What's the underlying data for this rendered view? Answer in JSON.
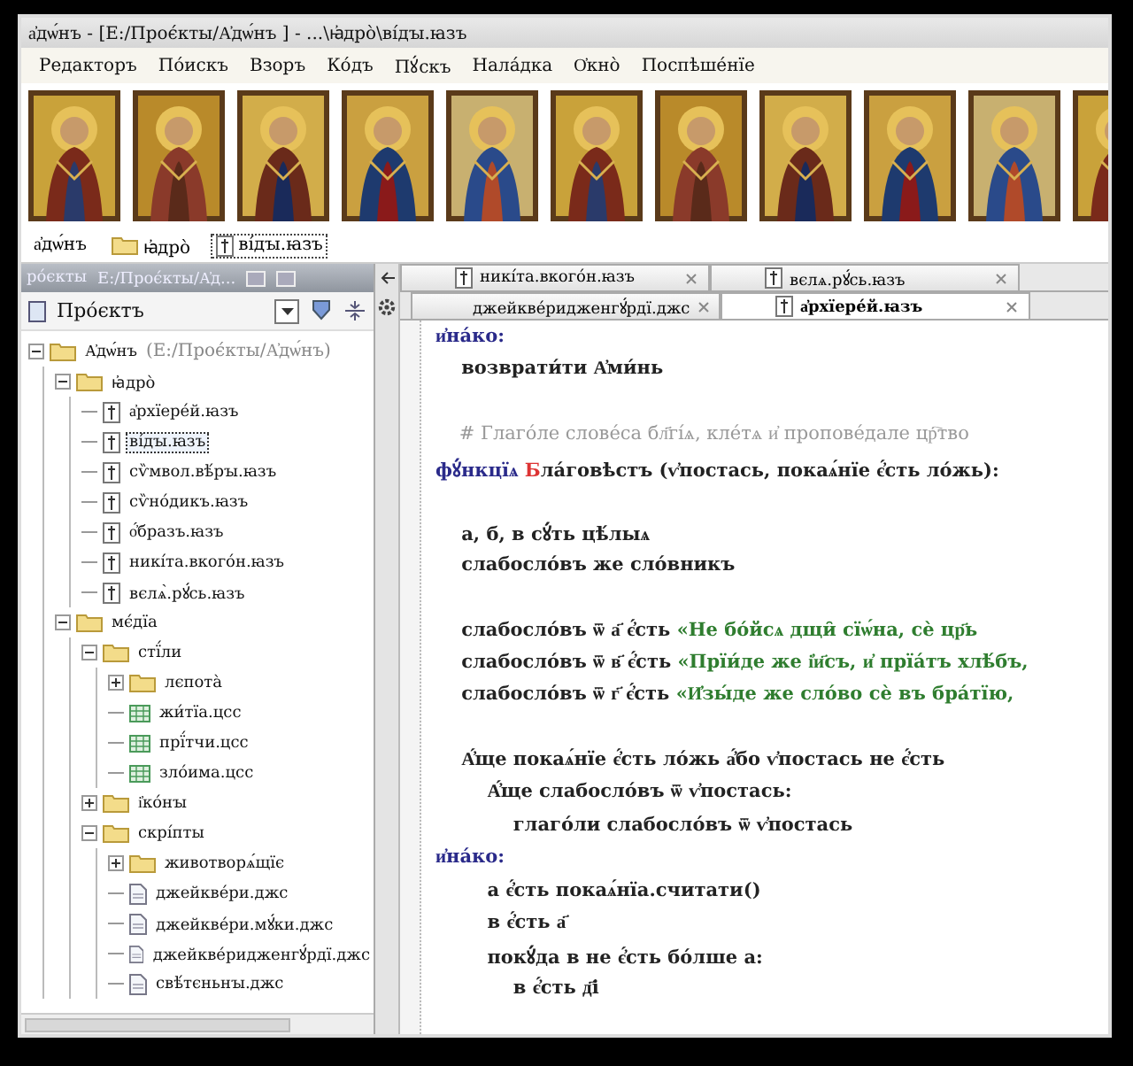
{
  "window": {
    "title": "а҆дѡ́нъ - [Е:/Проє́кты/А҆дѡ́нъ ] - ...\\ꙗ҆дро̀\\ві́дꙑ.ꙗзъ"
  },
  "menu": [
    "Редакторъ",
    "По́искъ",
    "Взоръ",
    "Ко́дъ",
    "Пꙋ́скъ",
    "Нала́дка",
    "О҆кно̀",
    "Поспѣше́нїе"
  ],
  "icon_strip": [
    {
      "kind": "picture"
    },
    {
      "kind": "picture"
    },
    {
      "kind": "picture"
    },
    {
      "kind": "picture"
    },
    {
      "kind": "picture"
    },
    {
      "kind": "picture"
    },
    {
      "kind": "picture"
    },
    {
      "kind": "picture"
    },
    {
      "kind": "picture"
    },
    {
      "kind": "picture"
    },
    {
      "kind": "picture"
    }
  ],
  "breadcrumb": [
    {
      "label": "а҆дѡ́нъ"
    },
    {
      "label": "ꙗ҆дро̀",
      "kind": "folder"
    },
    {
      "label": "ві́дꙑ.ꙗзъ",
      "kind": "source"
    }
  ],
  "project_panel": {
    "title": "ро́єкты",
    "path": "Е:/Проє́кты/А҆д...",
    "view": "Про́єктъ"
  },
  "tree": [
    {
      "label": "А҆дѡ́нъ",
      "note": "(Е:/Проє́кты/А҆дѡ́нъ)",
      "kind": "folder",
      "expanded": true,
      "selected": false,
      "children": [
        {
          "label": "ꙗ҆дро̀",
          "kind": "folder",
          "expanded": true,
          "selected": false,
          "children": [
            {
              "label": "а҆рхїере́й.ꙗзъ",
              "kind": "source",
              "selected": false
            },
            {
              "label": "ві́дꙑ.ꙗзъ",
              "kind": "source",
              "selected": true
            },
            {
              "label": "сѷмвол.вѣ́рꙑ.ꙗзъ",
              "kind": "source",
              "selected": false
            },
            {
              "label": "сѷно́дикъ.ꙗзъ",
              "kind": "source",
              "selected": false
            },
            {
              "label": "о҆́бразъ.ꙗзъ",
              "kind": "source",
              "selected": false
            },
            {
              "label": "никі́та.вкого́н.ꙗзъ",
              "kind": "source",
              "selected": false
            },
            {
              "label": "вєлѧ̀.рꙋ́сь.ꙗзъ",
              "kind": "source",
              "selected": false
            }
          ]
        },
        {
          "label": "мє́дїа",
          "kind": "folder",
          "expanded": true,
          "selected": false,
          "children": [
            {
              "label": "стї́ли",
              "kind": "folder",
              "expanded": true,
              "selected": false,
              "children": [
                {
                  "label": "лєпота̀",
                  "kind": "folder",
                  "expanded": false,
                  "selected": false
                },
                {
                  "label": "жи́тїа.цсс",
                  "kind": "style",
                  "selected": false
                },
                {
                  "label": "прї́тчи.цсс",
                  "kind": "style",
                  "selected": false
                },
                {
                  "label": "зло́има.цсс",
                  "kind": "style",
                  "selected": false
                }
              ]
            },
            {
              "label": "і҆ко́нꙑ",
              "kind": "folder",
              "expanded": false,
              "selected": false
            },
            {
              "label": "скрі́пты",
              "kind": "folder",
              "expanded": true,
              "selected": false,
              "children": [
                {
                  "label": "животворѧ́щїє",
                  "kind": "folder",
                  "expanded": false,
                  "selected": false
                },
                {
                  "label": "джейкве́ри.джс",
                  "kind": "script",
                  "selected": false
                },
                {
                  "label": "джейкве́ри.мꙋ́ки.джс",
                  "kind": "script",
                  "selected": false
                },
                {
                  "label": "джейкве́ридженгꙋ́рдї.джс",
                  "kind": "script",
                  "selected": false
                },
                {
                  "label": "свѣ́тєньнꙑ.джс",
                  "kind": "script",
                  "selected": false
                }
              ]
            }
          ]
        }
      ]
    }
  ],
  "tab_rows": [
    [
      {
        "label": "никі́та.вкого́н.ꙗзъ",
        "kind": "source",
        "selected": false
      },
      {
        "label": "вєлѧ.рꙋ́сь.ꙗзъ",
        "kind": "source",
        "selected": false
      }
    ],
    [
      {
        "label": "джейкве́ридженгꙋ́рдї.джс",
        "kind": "script",
        "selected": false
      },
      {
        "label": "а҆рхїере́й.ꙗзъ",
        "kind": "source",
        "selected": true
      }
    ]
  ],
  "code": [
    {
      "kind": "text",
      "segments": [
        {
          "text": "и҆на́ко:",
          "kind": "keyword"
        }
      ]
    },
    {
      "kind": "text",
      "segments": [
        {
          "text": "    возврати́ти А҆ми́нь",
          "kind": "plain"
        }
      ]
    },
    {
      "kind": "blank"
    },
    {
      "kind": "text",
      "segments": [
        {
          "text": "    # Глаго́ле слове́са бл҃гі́ѧ, кле́тѧ и҆ пропове́дале цр҇тво",
          "kind": "comment"
        }
      ]
    },
    {
      "kind": "text",
      "segments": [
        {
          "text": "фꙋ́нкцїѧ ",
          "kind": "keyword"
        },
        {
          "text": "Б",
          "kind": "name"
        },
        {
          "text": "ла́говѣстъ (ѵ҆постась, покаѧ́нїе є҆́сть ло́жь):",
          "kind": "plain"
        }
      ]
    },
    {
      "kind": "blank"
    },
    {
      "kind": "text",
      "segments": [
        {
          "text": "    а, б, в сꙋ́ть цѣ́лыѧ",
          "kind": "plain"
        }
      ]
    },
    {
      "kind": "text",
      "segments": [
        {
          "text": "    слабосло́въ же сло́вникъ",
          "kind": "plain"
        }
      ]
    },
    {
      "kind": "blank"
    },
    {
      "kind": "text",
      "segments": [
        {
          "text": "    слабосло́въ ѿ а҃ є҆́сть ",
          "kind": "plain"
        },
        {
          "text": "«Не бо́йсѧ дщи̑ сїѡ́на, сѐ цр҃ь",
          "kind": "string"
        }
      ]
    },
    {
      "kind": "text",
      "segments": [
        {
          "text": "    слабосло́въ ѿ в҃ є҆́сть ",
          "kind": "plain"
        },
        {
          "text": "«Прїи́де же і҆и҃съ, и҆ прїа́тъ хлѣ́бъ,",
          "kind": "string"
        }
      ]
    },
    {
      "kind": "text",
      "segments": [
        {
          "text": "    слабосло́въ ѿ г҃ є҆́сть ",
          "kind": "plain"
        },
        {
          "text": "«И҆зы́де же сло́во сѐ въ бра́тїю,",
          "kind": "string"
        }
      ]
    },
    {
      "kind": "blank"
    },
    {
      "kind": "text",
      "segments": [
        {
          "text": "    А҆́ще покаѧ́нїе є҆́сть ло́жь а҆́бо ѵ҆постась не є҆́сть",
          "kind": "plain"
        }
      ]
    },
    {
      "kind": "text",
      "segments": [
        {
          "text": "        А҆́ще слабосло́въ ѿ ѵ҆постась:",
          "kind": "plain"
        }
      ]
    },
    {
      "kind": "text",
      "segments": [
        {
          "text": "            глаго́ли слабосло́въ ѿ ѵ҆постась",
          "kind": "plain"
        }
      ]
    },
    {
      "kind": "text",
      "segments": [
        {
          "text": "и҆на́ко:",
          "kind": "keyword"
        }
      ]
    },
    {
      "kind": "text",
      "segments": [
        {
          "text": "        а є҆́сть покаѧ́нїа.считати()",
          "kind": "plain"
        }
      ]
    },
    {
      "kind": "text",
      "segments": [
        {
          "text": "        в є҆́сть а҃",
          "kind": "plain"
        }
      ]
    },
    {
      "kind": "text",
      "segments": [
        {
          "text": "        покꙋ́да в не є҆́сть бо́лше а:",
          "kind": "plain"
        }
      ]
    },
    {
      "kind": "text",
      "segments": [
        {
          "text": "            в є҆́сть д҃і",
          "kind": "plain"
        }
      ]
    }
  ]
}
